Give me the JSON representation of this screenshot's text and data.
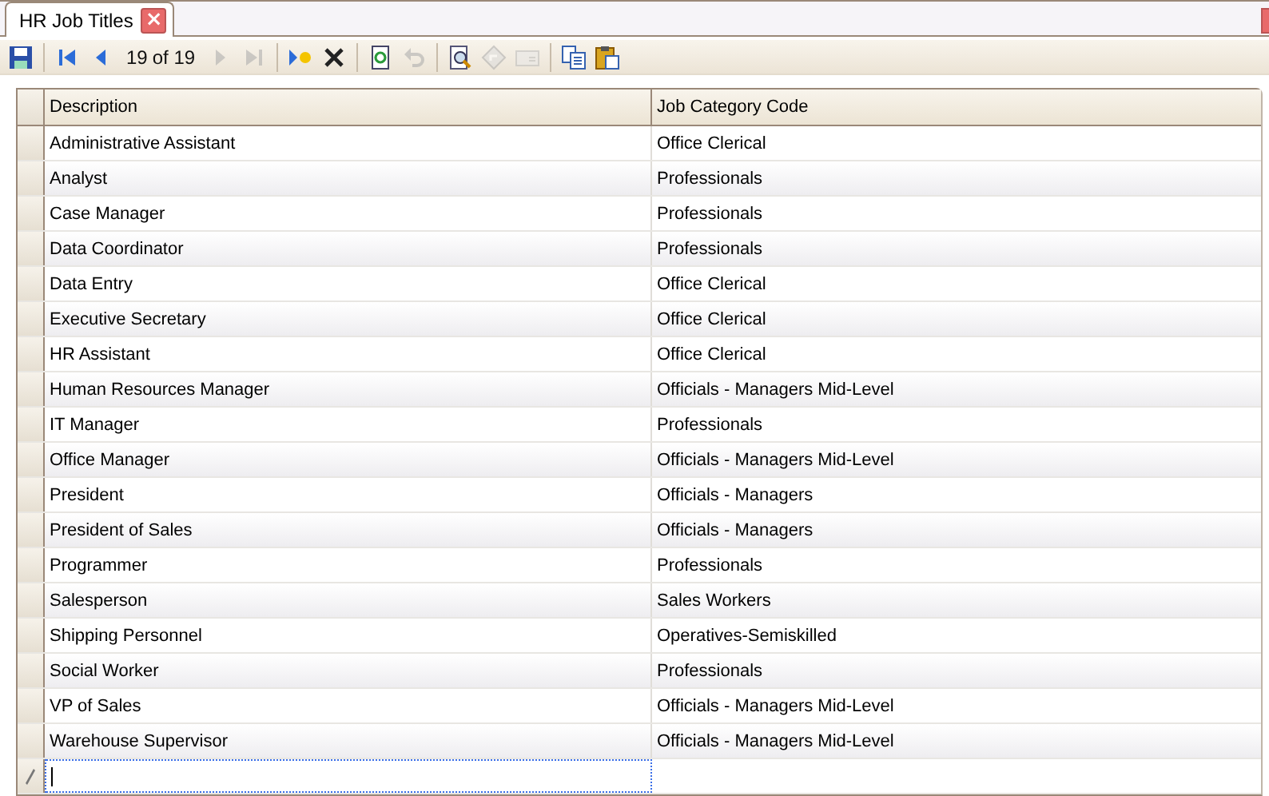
{
  "tab": {
    "title": "HR Job Titles",
    "close": "×"
  },
  "toolbar": [
    {
      "kind": "save",
      "disabled": false
    },
    {
      "kind": "sep"
    },
    {
      "kind": "first",
      "disabled": false
    },
    {
      "kind": "prev",
      "disabled": false
    },
    {
      "kind": "position",
      "text": "19"
    },
    {
      "kind": "count",
      "text": "of 19"
    },
    {
      "kind": "next",
      "disabled": true
    },
    {
      "kind": "last",
      "disabled": true
    },
    {
      "kind": "sep"
    },
    {
      "kind": "new",
      "disabled": false
    },
    {
      "kind": "delete",
      "disabled": false
    },
    {
      "kind": "sep"
    },
    {
      "kind": "refresh",
      "disabled": false
    },
    {
      "kind": "undo",
      "disabled": true
    },
    {
      "kind": "sep"
    },
    {
      "kind": "preview",
      "disabled": false
    },
    {
      "kind": "diamond",
      "disabled": true
    },
    {
      "kind": "mail",
      "disabled": true
    },
    {
      "kind": "sep"
    },
    {
      "kind": "copy",
      "disabled": false
    },
    {
      "kind": "paste",
      "disabled": false
    }
  ],
  "table": {
    "columns": [
      "Description",
      "Job Category Code"
    ],
    "rows": [
      [
        "Administrative Assistant",
        "Office Clerical"
      ],
      [
        "Analyst",
        "Professionals"
      ],
      [
        "Case Manager",
        "Professionals"
      ],
      [
        "Data Coordinator",
        "Professionals"
      ],
      [
        "Data Entry",
        "Office Clerical"
      ],
      [
        "Executive Secretary",
        "Office Clerical"
      ],
      [
        "HR Assistant",
        "Office Clerical"
      ],
      [
        "Human Resources Manager",
        "Officials - Managers Mid-Level"
      ],
      [
        "IT Manager",
        "Professionals"
      ],
      [
        "Office Manager",
        "Officials - Managers Mid-Level"
      ],
      [
        "President",
        "Officials - Managers"
      ],
      [
        "President of Sales",
        "Officials - Managers"
      ],
      [
        "Programmer",
        "Professionals"
      ],
      [
        "Salesperson",
        "Sales Workers"
      ],
      [
        "Shipping Personnel",
        "Operatives-Semiskilled"
      ],
      [
        "Social Worker",
        "Professionals"
      ],
      [
        "VP of Sales",
        "Officials - Managers Mid-Level"
      ],
      [
        "Warehouse Supervisor",
        "Officials - Managers Mid-Level"
      ]
    ]
  }
}
